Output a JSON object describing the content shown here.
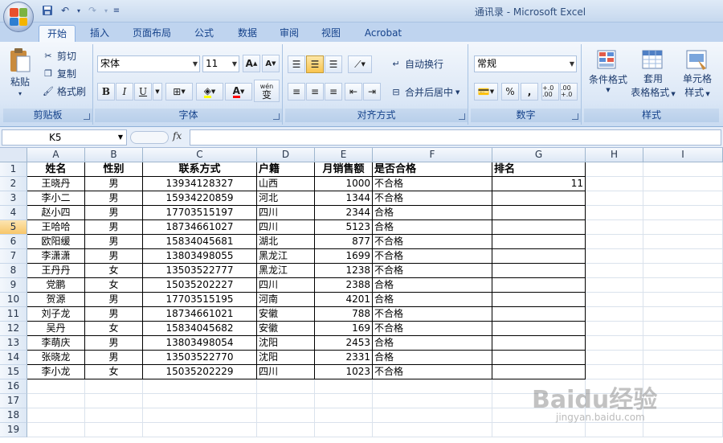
{
  "window": {
    "title": "通讯录 - Microsoft Excel"
  },
  "colors": {
    "accent": "#15428b",
    "selected_header": "#f7c66a",
    "ribbon_bg": "#dbe7f6"
  },
  "tabs": [
    "开始",
    "插入",
    "页面布局",
    "公式",
    "数据",
    "审阅",
    "视图",
    "Acrobat"
  ],
  "ribbon": {
    "clipboard": {
      "paste": "粘贴",
      "cut": "剪切",
      "copy": "复制",
      "format_painter": "格式刷",
      "label": "剪贴板"
    },
    "font": {
      "name": "宋体",
      "size": "11",
      "bold": "B",
      "italic": "I",
      "underline": "U",
      "label": "字体",
      "grow": "A",
      "shrink": "A",
      "wen": "wén",
      "phonetic": "变"
    },
    "alignment": {
      "wrap": "自动换行",
      "merge": "合并后居中",
      "label": "对齐方式"
    },
    "number": {
      "format": "常规",
      "percent": "%",
      "comma": ",",
      "inc_decimal": "+.0 .00",
      "dec_decimal": ".00 +.0",
      "label": "数字"
    },
    "styles": {
      "conditional": "条件格式",
      "table_line1": "套用",
      "table_line2": "表格格式",
      "cell_line1": "单元格",
      "cell_line2": "样式",
      "label": "样式"
    }
  },
  "formula_bar": {
    "name_box": "K5",
    "fx": "fx",
    "value": ""
  },
  "columns": [
    "A",
    "B",
    "C",
    "D",
    "E",
    "F",
    "G",
    "H",
    "I"
  ],
  "rows": [
    "1",
    "2",
    "3",
    "4",
    "5",
    "6",
    "7",
    "8",
    "9",
    "10",
    "11",
    "12",
    "13",
    "14",
    "15",
    "16",
    "17",
    "18",
    "19"
  ],
  "table": {
    "headers": [
      "姓名",
      "性别",
      "联系方式",
      "户籍",
      "月销售额",
      "是否合格",
      "排名"
    ],
    "data": [
      [
        "王晓丹",
        "男",
        "13934128327",
        "山西",
        "1000",
        "不合格",
        "11"
      ],
      [
        "李小二",
        "男",
        "15934220859",
        "河北",
        "1344",
        "不合格",
        ""
      ],
      [
        "赵小四",
        "男",
        "17703515197",
        "四川",
        "2344",
        "合格",
        ""
      ],
      [
        "王哈哈",
        "男",
        "18734661027",
        "四川",
        "5123",
        "合格",
        ""
      ],
      [
        "欧阳缓",
        "男",
        "15834045681",
        "湖北",
        "877",
        "不合格",
        ""
      ],
      [
        "李潇潇",
        "男",
        "13803498055",
        "黑龙江",
        "1699",
        "不合格",
        ""
      ],
      [
        "王丹丹",
        "女",
        "13503522777",
        "黑龙江",
        "1238",
        "不合格",
        ""
      ],
      [
        "党鹏",
        "女",
        "15035202227",
        "四川",
        "2388",
        "合格",
        ""
      ],
      [
        "贺源",
        "男",
        "17703515195",
        "河南",
        "4201",
        "合格",
        ""
      ],
      [
        "刘子龙",
        "男",
        "18734661021",
        "安徽",
        "788",
        "不合格",
        ""
      ],
      [
        "吴丹",
        "女",
        "15834045682",
        "安徽",
        "169",
        "不合格",
        ""
      ],
      [
        "李萌庆",
        "男",
        "13803498054",
        "沈阳",
        "2453",
        "合格",
        ""
      ],
      [
        "张晓龙",
        "男",
        "13503522770",
        "沈阳",
        "2331",
        "合格",
        ""
      ],
      [
        "李小龙",
        "女",
        "15035202229",
        "四川",
        "1023",
        "不合格",
        ""
      ]
    ]
  },
  "watermark": {
    "logo": "Baidu经验",
    "url": "jingyan.baidu.com"
  }
}
